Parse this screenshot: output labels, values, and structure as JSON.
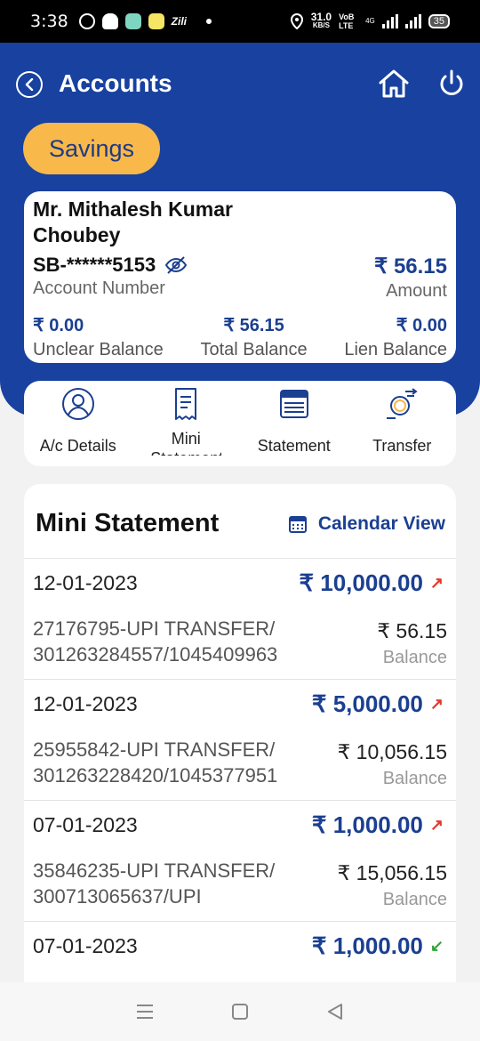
{
  "status_bar": {
    "time": "3:38",
    "speed_value": "31.0",
    "speed_unit": "KB/S",
    "network": "VoB LTE",
    "signal_label": "4G",
    "battery": "35"
  },
  "header": {
    "title": "Accounts",
    "tab_label": "Savings",
    "color": "#1841a0"
  },
  "account": {
    "name": "Mr. Mithalesh Kumar Choubey",
    "number": "SB-******5153",
    "number_label": "Account Number",
    "amount": "₹ 56.15",
    "amount_label": "Amount",
    "unclear_balance": "₹ 0.00",
    "unclear_label": "Unclear Balance",
    "total_balance": "₹ 56.15",
    "total_label": "Total Balance",
    "lien_balance": "₹ 0.00",
    "lien_label": "Lien Balance"
  },
  "actions": [
    {
      "label": "A/c Details",
      "icon": "user-circle-icon"
    },
    {
      "label": "Mini Statement",
      "icon": "receipt-icon"
    },
    {
      "label": "Statement",
      "icon": "calendar-grid-icon"
    },
    {
      "label": "Transfer",
      "icon": "rupee-exchange-icon"
    }
  ],
  "mini_statement": {
    "title": "Mini Statement",
    "calendar_view_label": "Calendar View",
    "transactions": [
      {
        "date": "12-01-2023",
        "amount": "₹ 10,000.00",
        "direction": "debit",
        "desc_line1": "27176795-UPI TRANSFER/",
        "desc_line2": "301263284557/1045409963",
        "balance": "₹ 56.15",
        "balance_label": "Balance"
      },
      {
        "date": "12-01-2023",
        "amount": "₹ 5,000.00",
        "direction": "debit",
        "desc_line1": "25955842-UPI TRANSFER/",
        "desc_line2": "301263228420/1045377951",
        "balance": "₹ 10,056.15",
        "balance_label": "Balance"
      },
      {
        "date": "07-01-2023",
        "amount": "₹ 1,000.00",
        "direction": "debit",
        "desc_line1": "35846235-UPI TRANSFER/",
        "desc_line2": "300713065637/UPI",
        "balance": "₹ 15,056.15",
        "balance_label": "Balance"
      },
      {
        "date": "07-01-2023",
        "amount": "₹ 1,000.00",
        "direction": "credit",
        "desc_line1": "",
        "desc_line2": "",
        "balance": "",
        "balance_label": ""
      }
    ]
  },
  "colors": {
    "accent_blue": "#1b3f91",
    "tab_orange": "#f9b84a",
    "debit_red": "#e23a2b",
    "credit_green": "#2ea836"
  }
}
